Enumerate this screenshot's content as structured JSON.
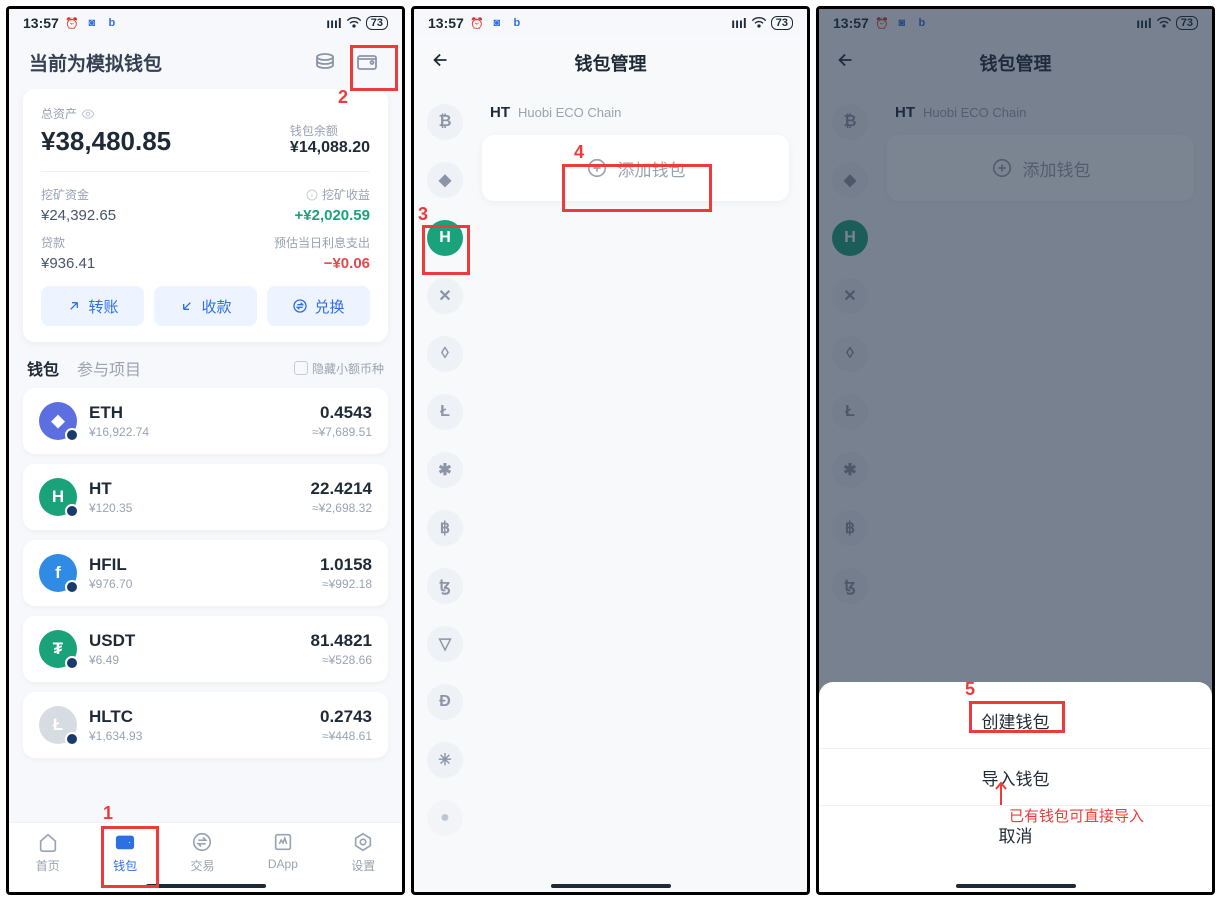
{
  "status": {
    "time": "13:57",
    "battery": "73"
  },
  "s1": {
    "header_title": "当前为模拟钱包",
    "total_label": "总资产",
    "total_value": "¥38,480.85",
    "balance_label": "钱包余额",
    "balance_value": "¥14,088.20",
    "mining_label": "挖矿资金",
    "mining_value": "¥24,392.65",
    "mining_income_label": "挖矿收益",
    "mining_income_value": "+¥2,020.59",
    "loan_label": "贷款",
    "loan_value": "¥936.41",
    "interest_label": "预估当日利息支出",
    "interest_value": "−¥0.06",
    "btn_transfer": "转账",
    "btn_receive": "收款",
    "btn_swap": "兑换",
    "tab_wallet": "钱包",
    "tab_projects": "参与项目",
    "hide_small": "隐藏小额币种",
    "tokens": [
      {
        "sym": "ETH",
        "price": "¥16,922.74",
        "amt": "0.4543",
        "val": "≈¥7,689.51",
        "color": "#5b6fe0"
      },
      {
        "sym": "HT",
        "price": "¥120.35",
        "amt": "22.4214",
        "val": "≈¥2,698.32",
        "color": "#1aa37a",
        "glyph": "H"
      },
      {
        "sym": "HFIL",
        "price": "¥976.70",
        "amt": "1.0158",
        "val": "≈¥992.18",
        "color": "#2f8be4",
        "glyph": "f"
      },
      {
        "sym": "USDT",
        "price": "¥6.49",
        "amt": "81.4821",
        "val": "≈¥528.66",
        "color": "#1aa37a",
        "glyph": "₮"
      },
      {
        "sym": "HLTC",
        "price": "¥1,634.93",
        "amt": "0.2743",
        "val": "≈¥448.61",
        "color": "#d7dbe2",
        "glyph": "Ł"
      }
    ],
    "nav": {
      "home": "首页",
      "wallet": "钱包",
      "trade": "交易",
      "dapp": "DApp",
      "settings": "设置"
    }
  },
  "s2": {
    "title": "钱包管理",
    "chain_sym": "HT",
    "chain_name": "Huobi ECO Chain",
    "add_wallet": "添加钱包"
  },
  "s3": {
    "title": "钱包管理",
    "chain_sym": "HT",
    "chain_name": "Huobi ECO Chain",
    "add_wallet": "添加钱包",
    "sheet": {
      "create": "创建钱包",
      "import": "导入钱包",
      "cancel": "取消"
    },
    "note": "已有钱包可直接导入"
  },
  "badges": {
    "b1": "1",
    "b2": "2",
    "b3": "3",
    "b4": "4",
    "b5": "5"
  }
}
